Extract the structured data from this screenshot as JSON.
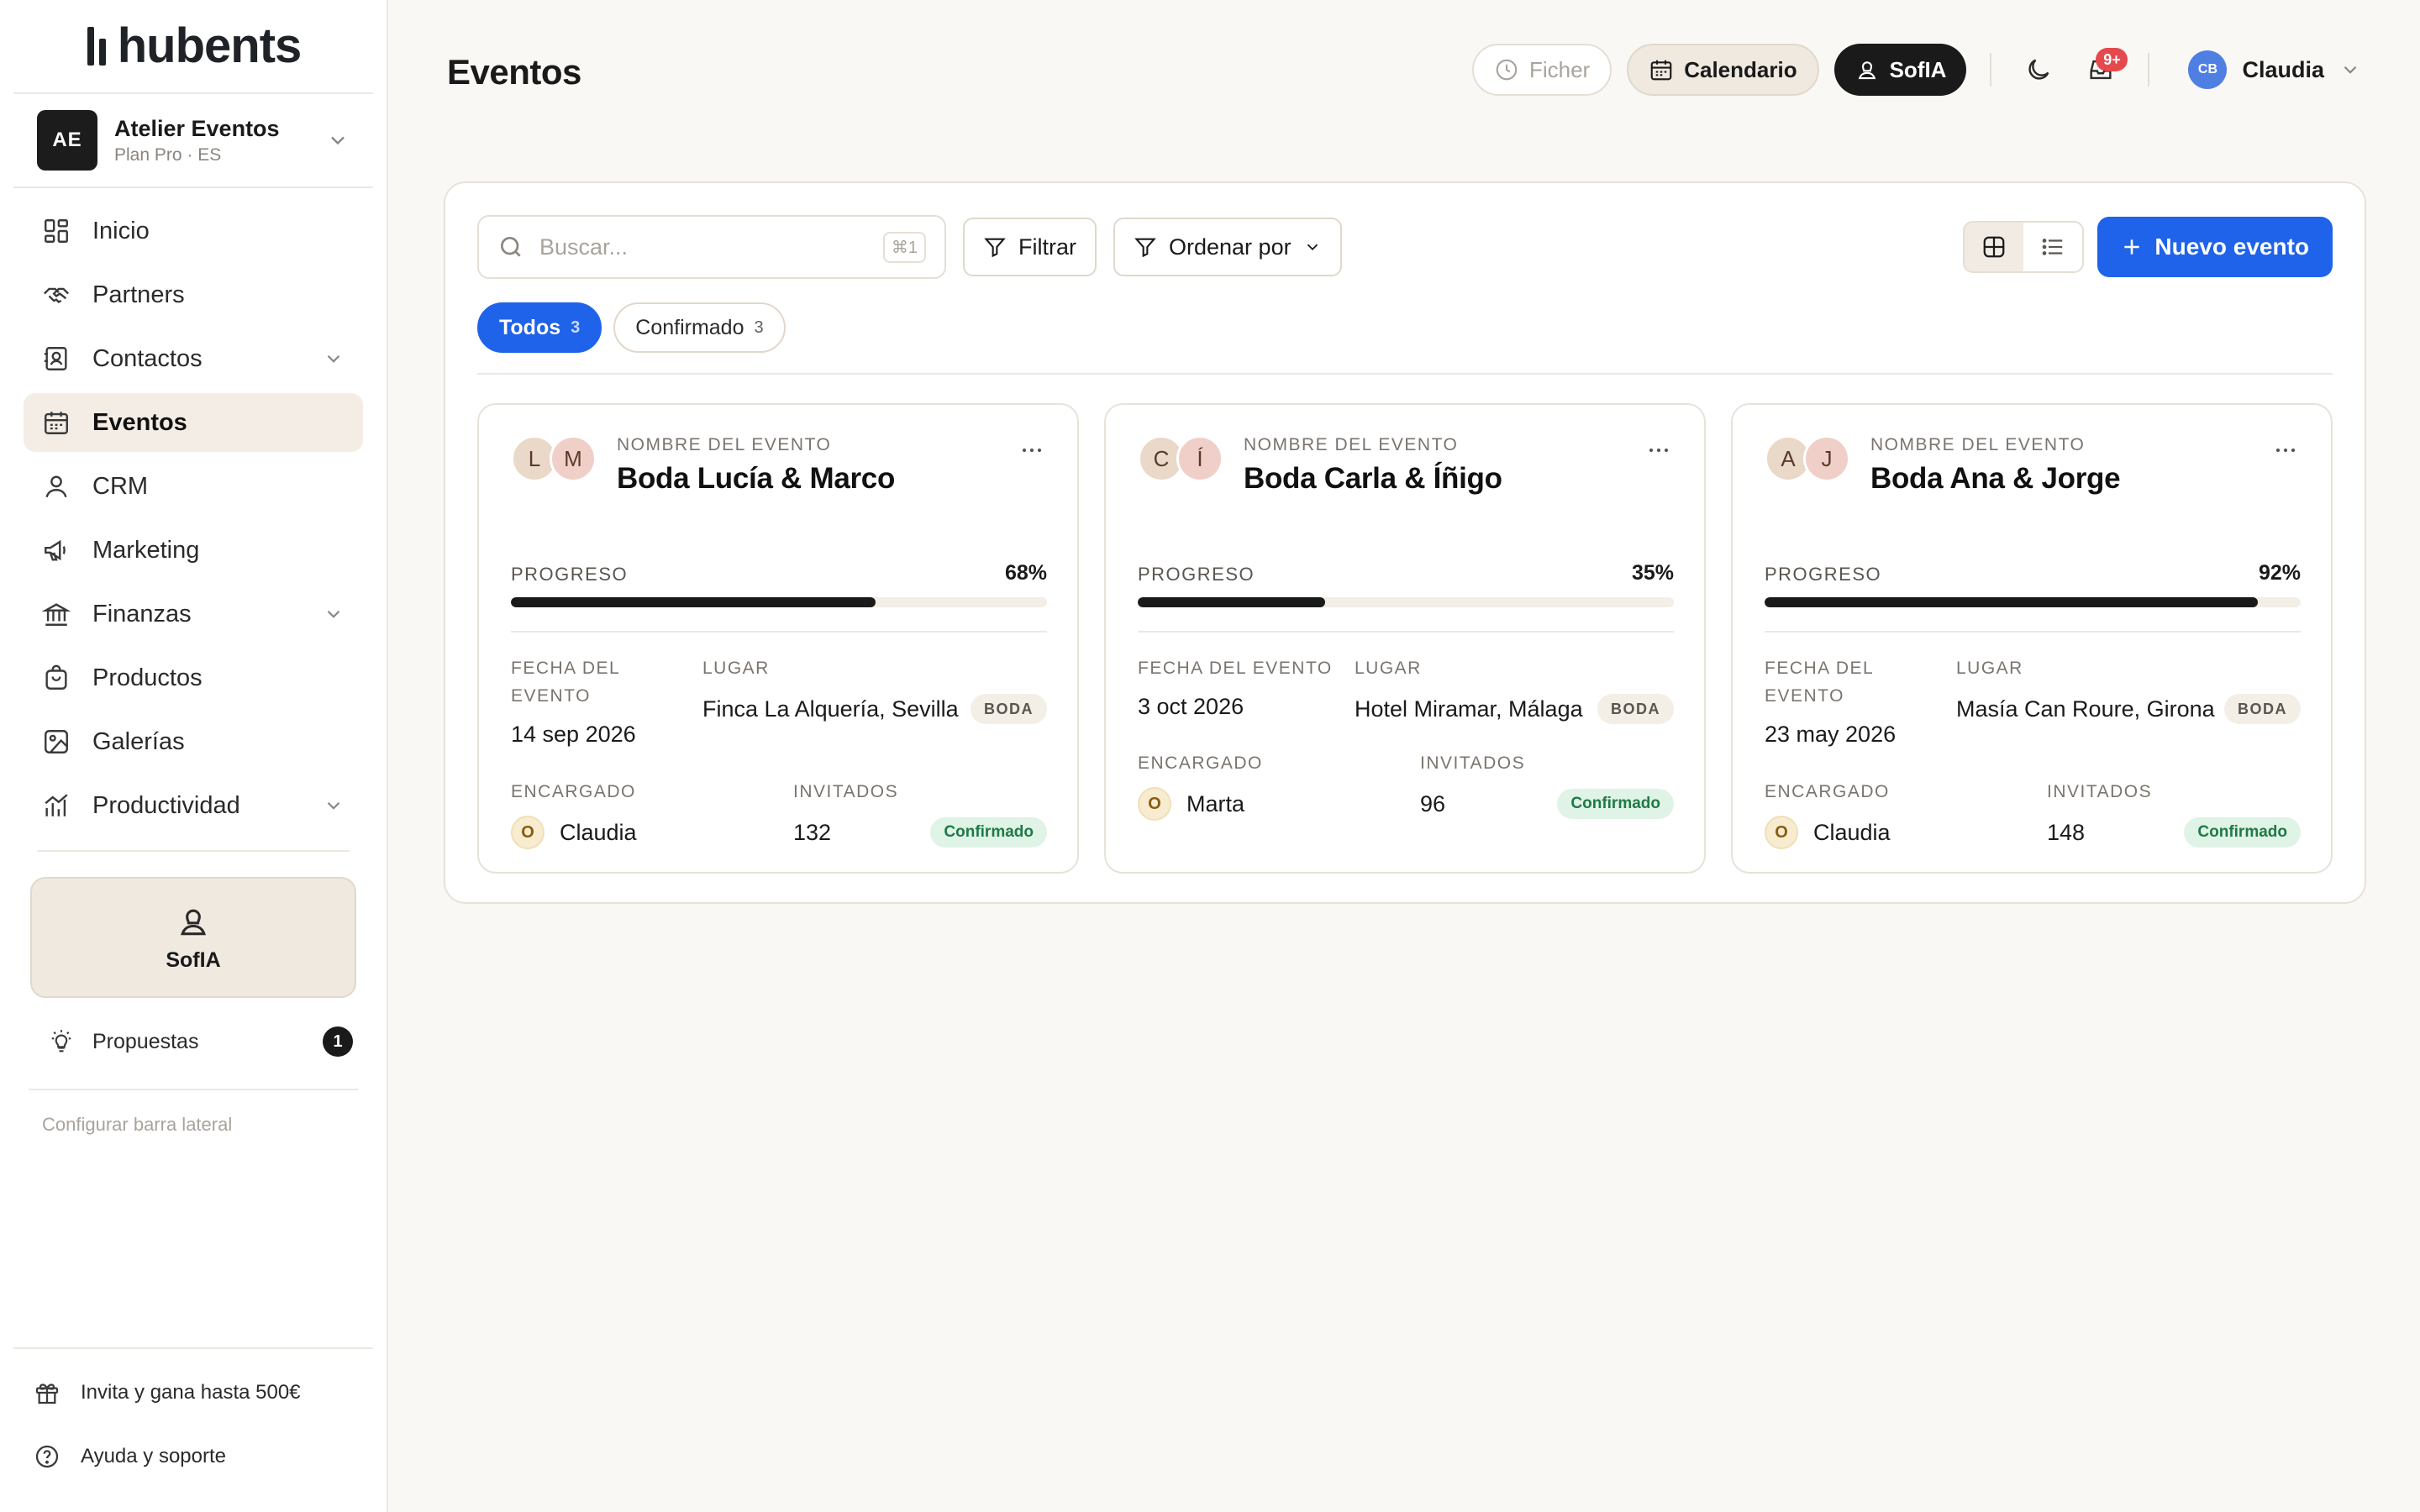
{
  "brand": {
    "name": "hubents"
  },
  "workspace": {
    "initials": "AE",
    "name": "Atelier Eventos",
    "plan": "Plan Pro · ES"
  },
  "sidebar": {
    "items": [
      {
        "label": "Inicio",
        "icon": "home-grid-icon"
      },
      {
        "label": "Partners",
        "icon": "handshake-icon"
      },
      {
        "label": "Contactos",
        "icon": "contacts-icon",
        "expandable": true
      },
      {
        "label": "Eventos",
        "icon": "calendar-icon",
        "active": true
      },
      {
        "label": "CRM",
        "icon": "user-icon"
      },
      {
        "label": "Marketing",
        "icon": "megaphone-icon"
      },
      {
        "label": "Finanzas",
        "icon": "bank-icon",
        "expandable": true
      },
      {
        "label": "Productos",
        "icon": "bag-icon"
      },
      {
        "label": "Galerías",
        "icon": "image-icon"
      },
      {
        "label": "Productividad",
        "icon": "chart-icon",
        "expandable": true
      }
    ],
    "sofia_label": "SofIA",
    "propuestas_label": "Propuestas",
    "propuestas_count": "1",
    "config_label": "Configurar barra lateral",
    "invite_label": "Invita y gana hasta 500€",
    "help_label": "Ayuda y soporte"
  },
  "header": {
    "title": "Eventos",
    "fichar_label": "Ficher",
    "calendario_label": "Calendario",
    "sofia_label": "SofIA",
    "notif_badge": "9+",
    "user_initials": "CB",
    "user_name": "Claudia"
  },
  "toolbar": {
    "search_placeholder": "Buscar...",
    "search_shortcut": "⌘1",
    "filter_label": "Filtrar",
    "sort_label": "Ordenar por",
    "new_event_label": "Nuevo evento"
  },
  "tabs": [
    {
      "label": "Todos",
      "count": "3",
      "active": true
    },
    {
      "label": "Confirmado",
      "count": "3",
      "active": false
    }
  ],
  "labels": {
    "event_name": "NOMBRE DEL EVENTO",
    "progress": "PROGRESO",
    "date": "FECHA DEL EVENTO",
    "place": "LUGAR",
    "owner": "ENCARGADO",
    "guests": "INVITADOS"
  },
  "events": [
    {
      "avatar1": "L",
      "avatar2": "M",
      "name": "Boda Lucía & Marco",
      "progress_text": "68%",
      "progress": 0.68,
      "date": "14 sep 2026",
      "place": "Finca La Alquería, Sevilla",
      "tag": "BODA",
      "owner_initial": "O",
      "owner": "Claudia",
      "guests": "132",
      "status": "Confirmado"
    },
    {
      "avatar1": "C",
      "avatar2": "Í",
      "name": "Boda Carla & Íñigo",
      "progress_text": "35%",
      "progress": 0.35,
      "date": "3 oct 2026",
      "place": "Hotel Miramar, Málaga",
      "tag": "BODA",
      "owner_initial": "O",
      "owner": "Marta",
      "guests": "96",
      "status": "Confirmado"
    },
    {
      "avatar1": "A",
      "avatar2": "J",
      "name": "Boda Ana & Jorge",
      "progress_text": "92%",
      "progress": 0.92,
      "date": "23 may 2026",
      "place": "Masía Can Roure, Girona",
      "tag": "BODA",
      "owner_initial": "O",
      "owner": "Claudia",
      "guests": "148",
      "status": "Confirmado"
    }
  ]
}
